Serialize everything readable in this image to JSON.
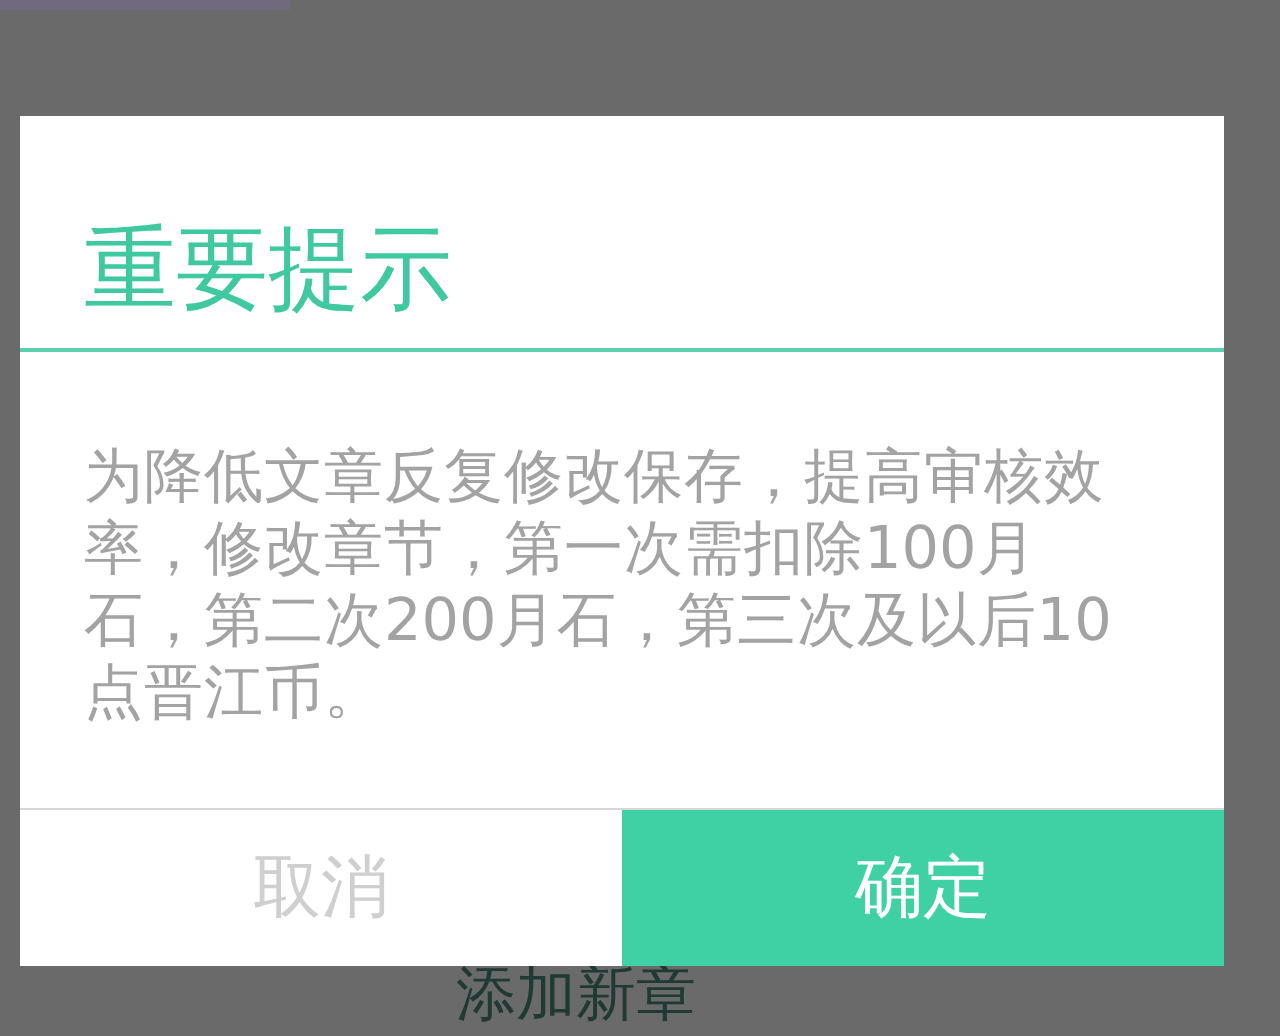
{
  "background": {
    "link": "添加新章"
  },
  "dialog": {
    "title": "重要提示",
    "message": "为降低文章反复修改保存，提高审核效率，修改章节，第一次需扣除100月石，第二次200月石，第三次及以后10点晋江币。",
    "buttons": [
      {
        "label": "取消",
        "kind": "cancel"
      },
      {
        "label": "确定",
        "kind": "confirm"
      }
    ]
  }
}
